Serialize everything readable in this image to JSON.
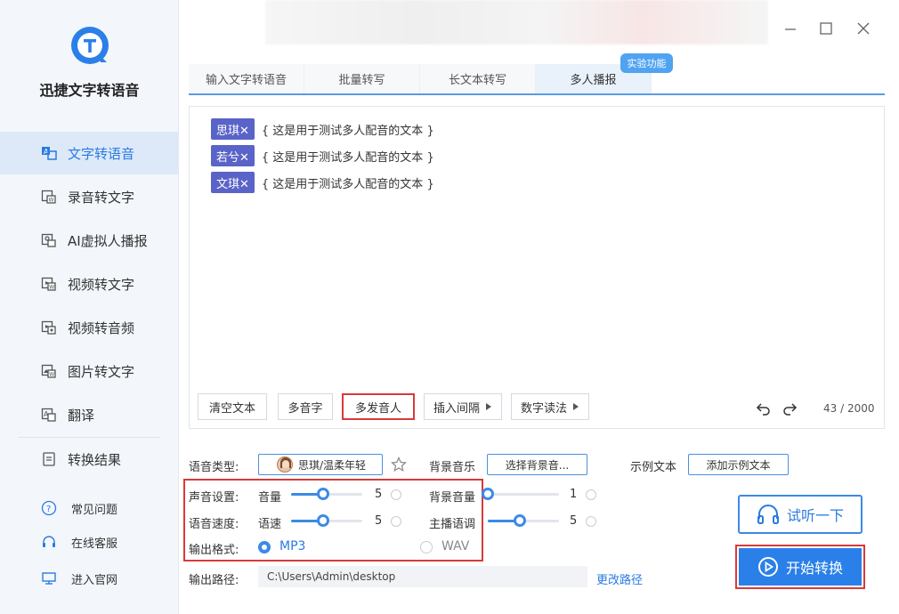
{
  "app": {
    "name": "迅捷文字转语音"
  },
  "sidebar": {
    "items": [
      {
        "label": "文字转语音",
        "icon": "text-to-speech-icon",
        "active": true
      },
      {
        "label": "录音转文字",
        "icon": "recording-icon"
      },
      {
        "label": "AI虚拟人播报",
        "icon": "virtual-human-icon"
      },
      {
        "label": "视频转文字",
        "icon": "video-text-icon"
      },
      {
        "label": "视频转音频",
        "icon": "video-audio-icon"
      },
      {
        "label": "图片转文字",
        "icon": "image-text-icon"
      },
      {
        "label": "翻译",
        "icon": "translate-icon"
      },
      {
        "label": "转换结果",
        "icon": "results-icon"
      }
    ],
    "footer": [
      {
        "label": "常见问题",
        "icon": "question-icon"
      },
      {
        "label": "在线客服",
        "icon": "headset-icon"
      },
      {
        "label": "进入官网",
        "icon": "monitor-icon"
      }
    ]
  },
  "tabs": [
    {
      "label": "输入文字转语音"
    },
    {
      "label": "批量转写"
    },
    {
      "label": "长文本转写"
    },
    {
      "label": "多人播报",
      "active": true
    }
  ],
  "tab_badge": "实验功能",
  "editor": {
    "lines": [
      {
        "speaker": "思琪✕",
        "text": "{ 这是用于测试多人配音的文本 }"
      },
      {
        "speaker": "若兮✕",
        "text": "{ 这是用于测试多人配音的文本 }"
      },
      {
        "speaker": "文琪✕",
        "text": "{ 这是用于测试多人配音的文本 }"
      }
    ],
    "buttons": {
      "clear": "清空文本",
      "polyphone": "多音字",
      "multi_speaker": "多发音人",
      "insert_pause": "插入间隔",
      "number_reading": "数字读法"
    },
    "counter": "43 / 2000"
  },
  "settings": {
    "voice_type_label": "语音类型:",
    "voice_value": "思琪/温柔年轻",
    "bg_music_label": "背景音乐",
    "bg_music_button": "选择背景音...",
    "sample_label": "示例文本",
    "sample_button": "添加示例文本",
    "sound_label": "声音设置:",
    "volume_label": "音量",
    "volume_value": "5",
    "bg_volume_label": "背景音量",
    "bg_volume_value": "1",
    "speed_label": "语音速度:",
    "rate_label": "语速",
    "rate_value": "5",
    "pitch_label": "主播语调",
    "pitch_value": "5",
    "format_label": "输出格式:",
    "format_mp3": "MP3",
    "format_wav": "WAV",
    "path_label": "输出路径:",
    "path_value": "C:\\Users\\Admin\\desktop",
    "change_path": "更改路径"
  },
  "sliders": {
    "volume": 0.45,
    "bg_volume": 0.0,
    "rate": 0.45,
    "pitch": 0.45
  },
  "actions": {
    "listen": "试听一下",
    "start": "开始转换"
  },
  "colors": {
    "accent": "#2a80e8",
    "highlight_red": "#d83a3a",
    "chip": "#5a63c8"
  }
}
